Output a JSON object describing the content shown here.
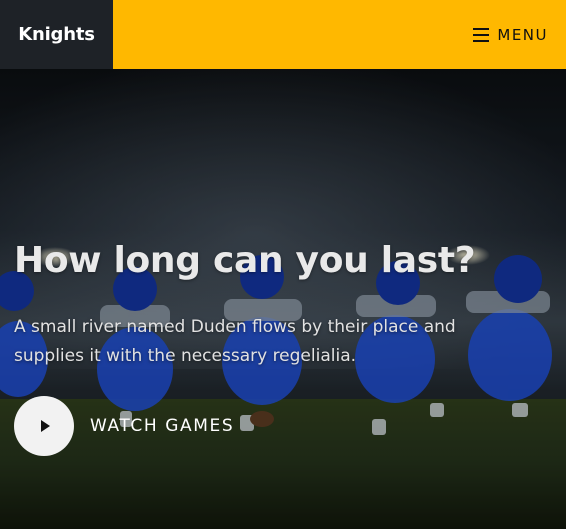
{
  "header": {
    "brand": "Knights",
    "menu_label": "MENU"
  },
  "hero": {
    "title": "How long can you last?",
    "subtitle": "A small river named Duden flows by their place and supplies it with the necessary regelialia.",
    "cta_label": "WATCH GAMES"
  },
  "colors": {
    "brand_bg": "#1e2227",
    "nav_bg": "#ffb800",
    "jersey_blue": "#1f4fd8"
  },
  "icons": {
    "menu": "hamburger-icon",
    "play": "play-icon"
  }
}
